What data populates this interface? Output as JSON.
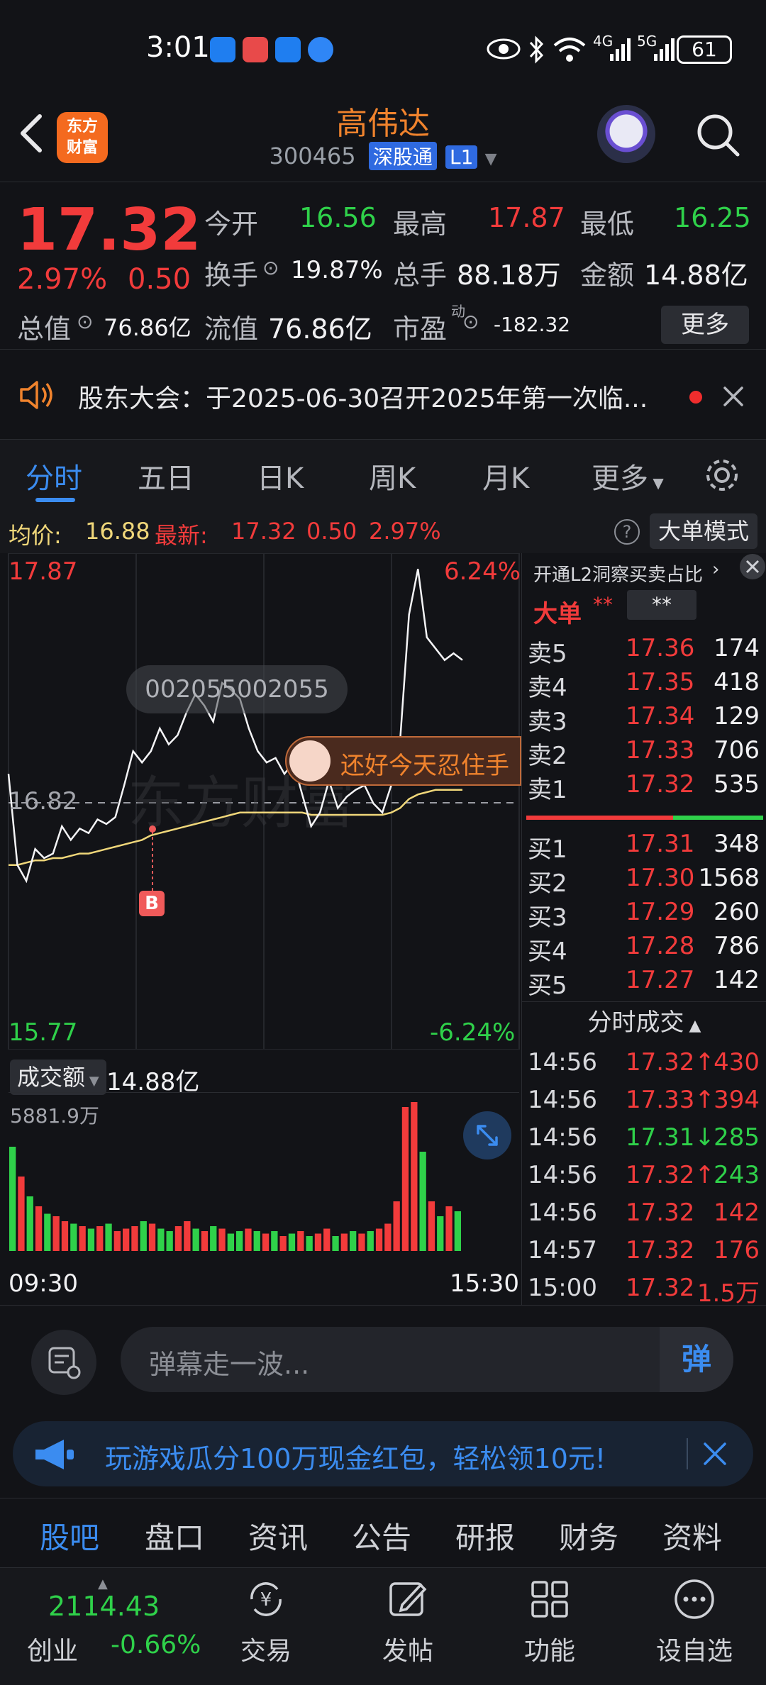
{
  "status_bar": {
    "time": "3:01",
    "battery": "61",
    "network_1": "4G",
    "network_2": "5G"
  },
  "header": {
    "stock_name": "高伟达",
    "stock_code": "300465",
    "tag_connect": "深股通",
    "tag_level": "L1",
    "logo_line1": "东方",
    "logo_line2": "财富"
  },
  "quote": {
    "price": "17.32",
    "change_pct": "2.97%",
    "change": "0.50",
    "open_label": "今开",
    "open": "16.56",
    "high_label": "最高",
    "high": "17.87",
    "low_label": "最低",
    "low": "16.25",
    "turnover_label": "换手",
    "turnover": "19.87%",
    "volume_label": "总手",
    "volume": "88.18万",
    "amount_label": "金额",
    "amount": "14.88亿",
    "mktcap_label": "总值",
    "mktcap": "76.86亿",
    "float_label": "流值",
    "float": "76.86亿",
    "pe_label": "市盈",
    "pe_sup": "动",
    "pe": "-182.32",
    "more_label": "更多"
  },
  "notice": {
    "text": "股东大会：于2025-06-30召开2025年第一次临..."
  },
  "tabs": [
    "分时",
    "五日",
    "日K",
    "周K",
    "月K",
    "更多"
  ],
  "avg_bar": {
    "avg_label": "均价:",
    "avg": "16.88",
    "latest_label": "最新:",
    "latest": "17.32",
    "change": "0.50",
    "change_pct": "2.97%",
    "big_mode": "大单模式"
  },
  "chart_labels": {
    "y_high": "17.87",
    "y_mid": "16.82",
    "y_low": "15.77",
    "pct_high": "6.24%",
    "pct_low": "-6.24%",
    "watermark_id": "002055002055",
    "bubble_text": "还好今天忍住手",
    "buy_marker": "B",
    "vol_label": "成交额",
    "vol_value": "14.88亿",
    "vol_max": "5881.9万",
    "time_start": "09:30",
    "time_end": "15:30"
  },
  "chart_data": {
    "type": "line",
    "series": [
      {
        "values": [
          16.95,
          16.55,
          16.48,
          16.62,
          16.58,
          16.6,
          16.72,
          16.66,
          16.71,
          16.69,
          16.75,
          16.73,
          16.76,
          16.9,
          17.05,
          17.0,
          17.05,
          17.15,
          17.08,
          17.12,
          17.22,
          17.3,
          17.25,
          17.18,
          17.35,
          17.32,
          17.28,
          17.15,
          17.05,
          17.0,
          17.02,
          16.95,
          17.0,
          16.86,
          16.72,
          16.78,
          16.92,
          16.8,
          16.85,
          16.88,
          16.9,
          16.82,
          16.78,
          16.9,
          17.1,
          17.65,
          17.85,
          17.55,
          17.5,
          17.45,
          17.48,
          17.45
        ]
      },
      {
        "values": [
          16.55,
          16.55,
          16.56,
          16.57,
          16.57,
          16.58,
          16.58,
          16.59,
          16.6,
          16.6,
          16.61,
          16.62,
          16.63,
          16.64,
          16.65,
          16.66,
          16.68,
          16.69,
          16.7,
          16.71,
          16.72,
          16.73,
          16.74,
          16.75,
          16.76,
          16.77,
          16.78,
          16.78,
          16.78,
          16.78,
          16.78,
          16.78,
          16.78,
          16.78,
          16.77,
          16.77,
          16.77,
          16.77,
          16.77,
          16.77,
          16.77,
          16.77,
          16.77,
          16.78,
          16.8,
          16.84,
          16.86,
          16.87,
          16.88,
          16.88,
          16.88,
          16.88
        ]
      }
    ],
    "ylim": [
      15.77,
      17.87
    ],
    "reference": 16.82,
    "volume": [
      42,
      30,
      22,
      18,
      15,
      14,
      12,
      11,
      10,
      9,
      10,
      11,
      8,
      9,
      10,
      12,
      11,
      9,
      8,
      10,
      12,
      9,
      8,
      10,
      9,
      7,
      8,
      9,
      8,
      7,
      8,
      6,
      7,
      8,
      6,
      7,
      9,
      6,
      7,
      8,
      7,
      8,
      9,
      11,
      20,
      58,
      60,
      40,
      20,
      14,
      18,
      16
    ],
    "volume_colors": [
      "green",
      "red",
      "green",
      "red",
      "green",
      "red",
      "red",
      "green",
      "red",
      "green",
      "red",
      "green",
      "red",
      "red",
      "red",
      "green",
      "red",
      "green",
      "green",
      "red",
      "red",
      "green",
      "red",
      "green",
      "red",
      "green",
      "green",
      "red",
      "green",
      "red",
      "green",
      "red",
      "green",
      "red",
      "green",
      "red",
      "red",
      "green",
      "red",
      "green",
      "red",
      "green",
      "red",
      "red",
      "red",
      "red",
      "red",
      "green",
      "red",
      "green",
      "red",
      "green"
    ]
  },
  "side": {
    "l2_title": "开通L2洞察买卖占比",
    "big_order": "大单",
    "big_order_stars1": "**",
    "big_order_stars2": "**",
    "asks": [
      {
        "label": "卖5",
        "price": "17.36",
        "vol": "174"
      },
      {
        "label": "卖4",
        "price": "17.35",
        "vol": "418"
      },
      {
        "label": "卖3",
        "price": "17.34",
        "vol": "129"
      },
      {
        "label": "卖2",
        "price": "17.33",
        "vol": "706"
      },
      {
        "label": "卖1",
        "price": "17.32",
        "vol": "535"
      }
    ],
    "bids": [
      {
        "label": "买1",
        "price": "17.31",
        "vol": "348"
      },
      {
        "label": "买2",
        "price": "17.30",
        "vol": "1568"
      },
      {
        "label": "买3",
        "price": "17.29",
        "vol": "260"
      },
      {
        "label": "买4",
        "price": "17.28",
        "vol": "786"
      },
      {
        "label": "买5",
        "price": "17.27",
        "vol": "142"
      }
    ],
    "trades_title": "分时成交",
    "trades": [
      {
        "time": "14:56",
        "price": "17.32↑",
        "vol": "430",
        "color": "red"
      },
      {
        "time": "14:56",
        "price": "17.33↑",
        "vol": "394",
        "color": "red"
      },
      {
        "time": "14:56",
        "price": "17.31↓",
        "vol": "285",
        "color": "green"
      },
      {
        "time": "14:56",
        "price": "17.32↑",
        "vol": "243",
        "color": "green"
      },
      {
        "time": "14:56",
        "price": "17.32",
        "vol": "142",
        "color": "red"
      },
      {
        "time": "14:57",
        "price": "17.32",
        "vol": "176",
        "color": "red"
      },
      {
        "time": "15:00",
        "price": "17.32",
        "vol": "1.5万",
        "color": "red"
      }
    ]
  },
  "danmu": {
    "placeholder": "弹幕走一波...",
    "button": "弹"
  },
  "promo": {
    "text": "玩游戏瓜分100万现金红包，轻松领10元!"
  },
  "bottom_tabs": [
    "股吧",
    "盘口",
    "资讯",
    "公告",
    "研报",
    "财务",
    "资料"
  ],
  "nav": {
    "index_value": "2114.43",
    "index_name": "创业",
    "index_change": "-0.66%",
    "trade": "交易",
    "post": "发帖",
    "function": "功能",
    "watchlist": "设自选"
  },
  "colors": {
    "up": "#f23b3b",
    "down": "#2fd14a",
    "accent": "#3b8cf0",
    "brand": "#f0832d",
    "avg_line": "#f0d77a"
  }
}
